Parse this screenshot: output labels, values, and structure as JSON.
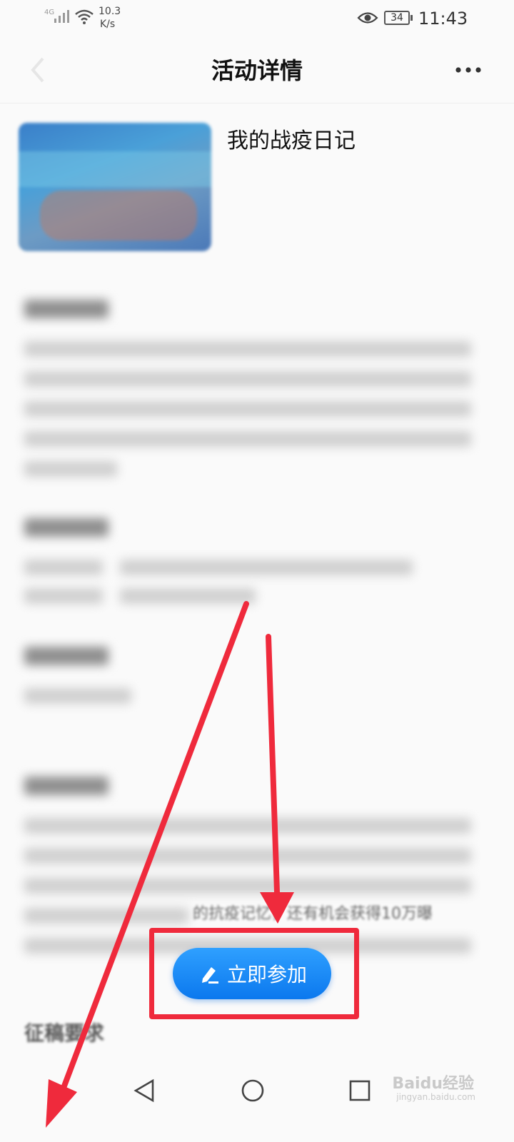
{
  "status_bar": {
    "network_type": "4G",
    "net_speed_value": "10.3",
    "net_speed_unit": "K/s",
    "battery": "34",
    "time": "11:43"
  },
  "header": {
    "title": "活动详情",
    "more_icon": "more-dots-icon",
    "back_icon": "back-chevron-icon"
  },
  "activity": {
    "name": "我的战疫日记"
  },
  "content": {
    "visible_snippet": "的抗疫记忆，还有机会获得10万曝",
    "section_title_tail": "征稿要求"
  },
  "join_button": {
    "label": "立即参加",
    "icon": "pencil-icon"
  },
  "annotation": {
    "color": "#ef2a3c"
  },
  "watermark": {
    "brand": "Baidu经验",
    "url": "jingyan.baidu.com"
  }
}
